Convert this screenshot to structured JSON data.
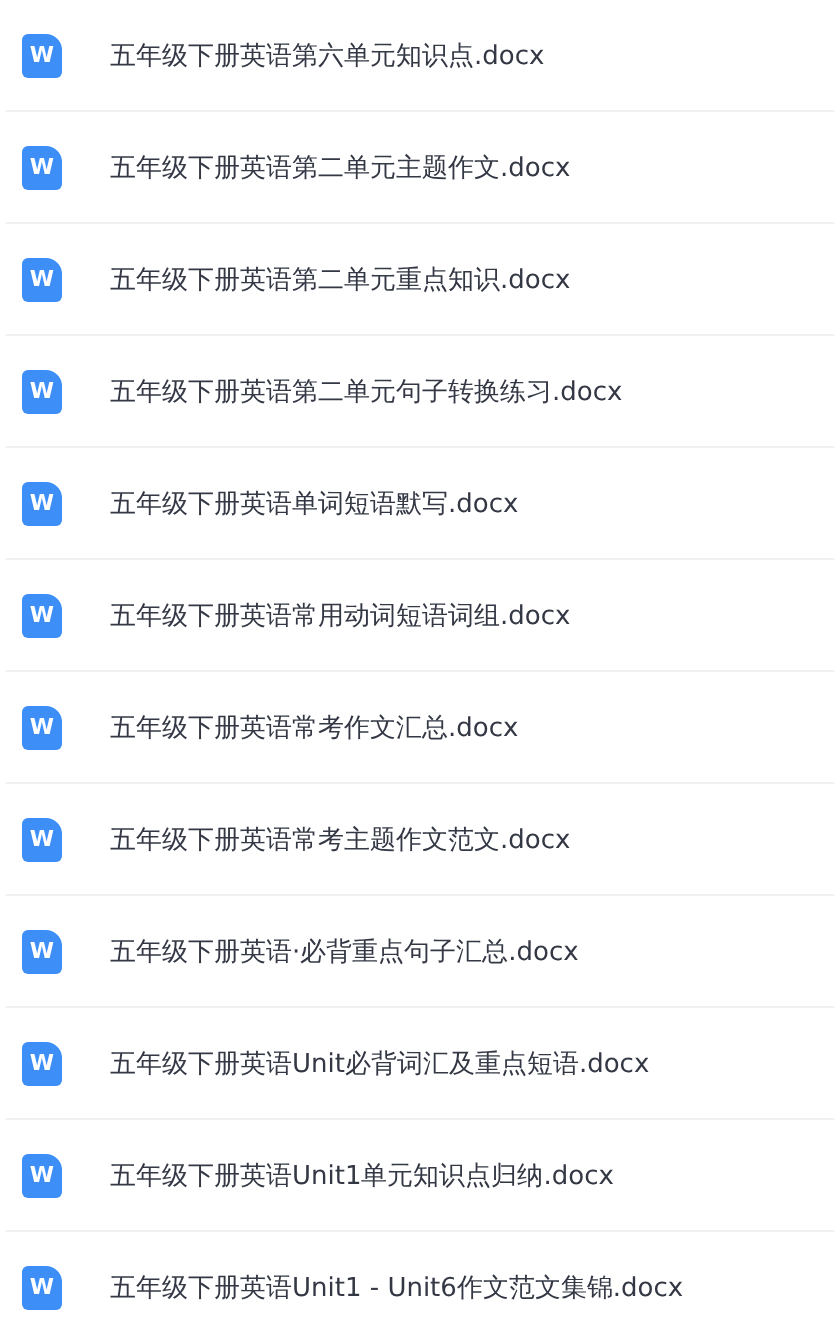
{
  "files": [
    {
      "icon_label": "W",
      "name": "五年级下册英语第六单元知识点.docx"
    },
    {
      "icon_label": "W",
      "name": "五年级下册英语第二单元主题作文.docx"
    },
    {
      "icon_label": "W",
      "name": "五年级下册英语第二单元重点知识.docx"
    },
    {
      "icon_label": "W",
      "name": "五年级下册英语第二单元句子转换练习.docx"
    },
    {
      "icon_label": "W",
      "name": "五年级下册英语单词短语默写.docx"
    },
    {
      "icon_label": "W",
      "name": "五年级下册英语常用动词短语词组.docx"
    },
    {
      "icon_label": "W",
      "name": "五年级下册英语常考作文汇总.docx"
    },
    {
      "icon_label": "W",
      "name": "五年级下册英语常考主题作文范文.docx"
    },
    {
      "icon_label": "W",
      "name": "五年级下册英语·必背重点句子汇总.docx"
    },
    {
      "icon_label": "W",
      "name": "五年级下册英语Unit必背词汇及重点短语.docx"
    },
    {
      "icon_label": "W",
      "name": "五年级下册英语Unit1单元知识点归纳.docx"
    },
    {
      "icon_label": "W",
      "name": "五年级下册英语Unit1 - Unit6作文范文集锦.docx"
    }
  ]
}
